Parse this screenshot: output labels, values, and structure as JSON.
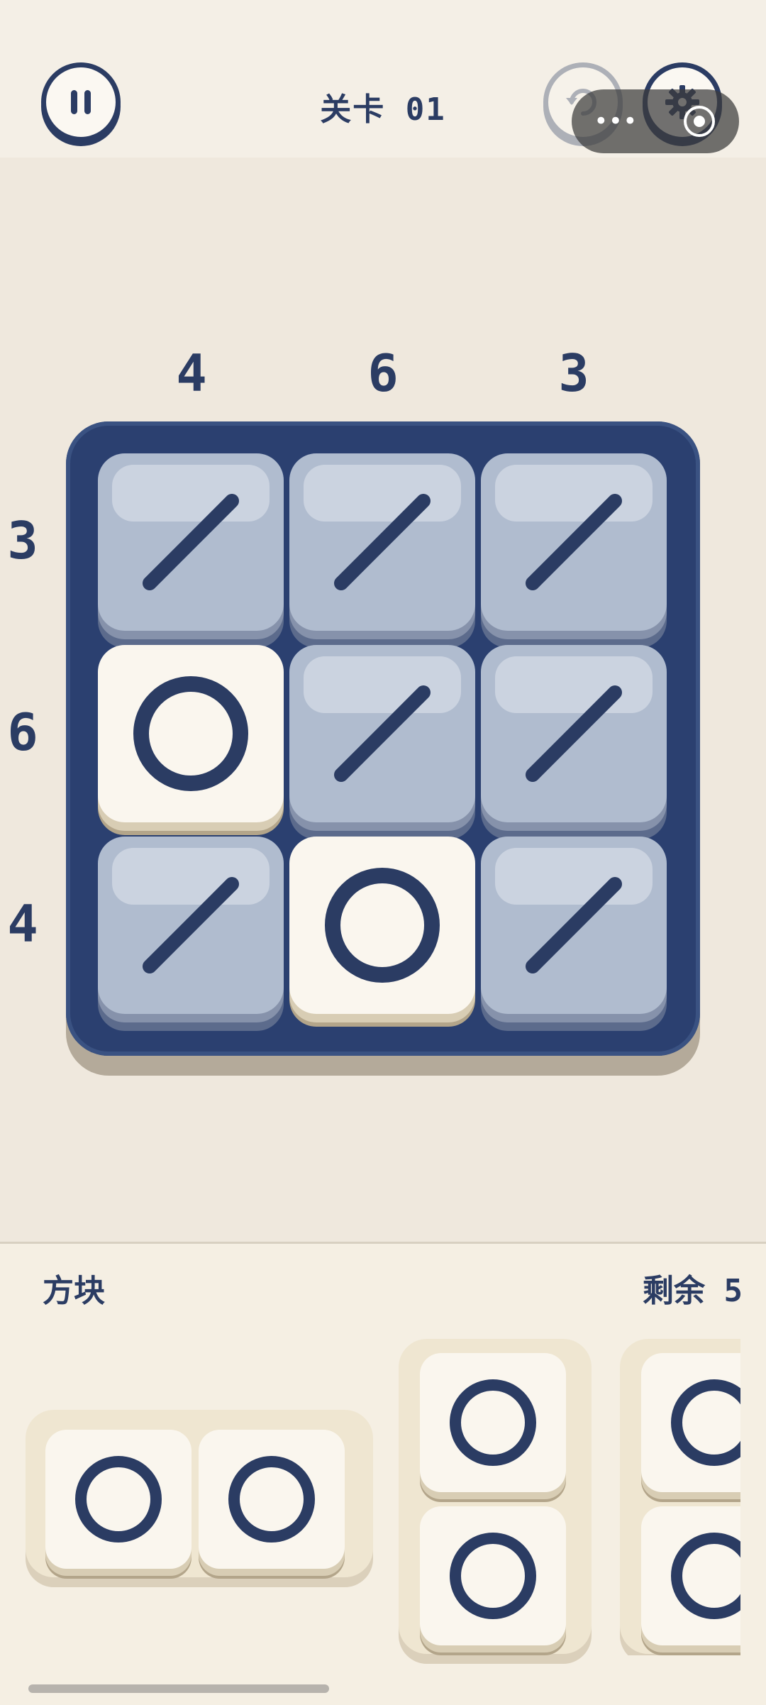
{
  "header": {
    "title": "关卡 01",
    "capsule_more": "•••"
  },
  "board": {
    "column_clues": [
      "4",
      "6",
      "3"
    ],
    "row_clues": [
      "3",
      "6",
      "4"
    ],
    "cells": [
      [
        "slash",
        "slash",
        "slash"
      ],
      [
        "circle",
        "slash",
        "slash"
      ],
      [
        "slash",
        "circle",
        "slash"
      ]
    ]
  },
  "tray": {
    "title": "方块",
    "remaining": "剩余 5"
  },
  "colors": {
    "navy": "#2b3c63",
    "board": "#2b4070",
    "slash_tile": "#b0bccf",
    "circle_tile": "#faf6ee",
    "background": "#efe8dd"
  },
  "icons": [
    "pause-icon",
    "undo-icon",
    "gear-icon",
    "more-icon",
    "target-icon",
    "slash-icon",
    "circle-icon"
  ]
}
